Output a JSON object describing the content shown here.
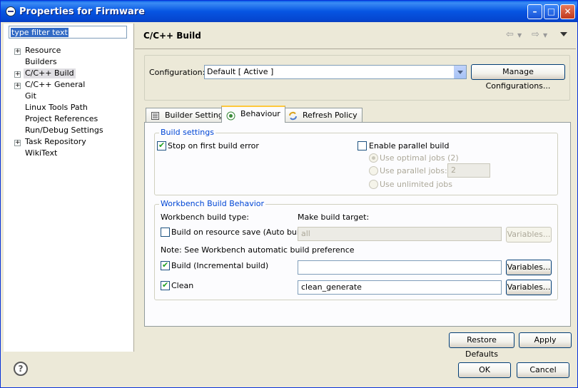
{
  "window": {
    "title": "Properties for Firmware"
  },
  "filter": {
    "placeholder": "type filter text"
  },
  "tree": [
    {
      "label": "Resource",
      "expandable": true
    },
    {
      "label": "Builders",
      "expandable": false
    },
    {
      "label": "C/C++ Build",
      "expandable": true,
      "selected": true
    },
    {
      "label": "C/C++ General",
      "expandable": true
    },
    {
      "label": "Git",
      "expandable": false
    },
    {
      "label": "Linux Tools Path",
      "expandable": false
    },
    {
      "label": "Project References",
      "expandable": false
    },
    {
      "label": "Run/Debug Settings",
      "expandable": false
    },
    {
      "label": "Task Repository",
      "expandable": true
    },
    {
      "label": "WikiText",
      "expandable": false
    }
  ],
  "page": {
    "title": "C/C++ Build"
  },
  "configuration": {
    "label": "Configuration:",
    "value": "Default  [ Active ]",
    "manage_label": "Manage Configurations..."
  },
  "tabs": [
    {
      "label": "Builder Settings",
      "active": false
    },
    {
      "label": "Behaviour",
      "active": true
    },
    {
      "label": "Refresh Policy",
      "active": false
    }
  ],
  "build_settings": {
    "title": "Build settings",
    "stop_on_error": {
      "label": "Stop on first build error",
      "checked": true
    },
    "parallel": {
      "label": "Enable parallel build",
      "checked": false
    },
    "optimal": {
      "label": "Use optimal jobs (2)",
      "selected": true
    },
    "parallel_jobs": {
      "label": "Use parallel jobs:",
      "value": "2"
    },
    "unlimited": {
      "label": "Use unlimited jobs"
    }
  },
  "workbench": {
    "title": "Workbench Build Behavior",
    "type_label": "Workbench build type:",
    "target_label": "Make build target:",
    "auto": {
      "label": "Build on resource save (Auto build)",
      "checked": false,
      "target": "all"
    },
    "note": "Note: See Workbench automatic build preference",
    "incremental": {
      "label": "Build (Incremental build)",
      "checked": true,
      "target": ""
    },
    "clean": {
      "label": "Clean",
      "checked": true,
      "target": "clean_generate"
    },
    "variables_label": "Variables..."
  },
  "buttons": {
    "restore": "Restore Defaults",
    "apply": "Apply",
    "ok": "OK",
    "cancel": "Cancel"
  }
}
